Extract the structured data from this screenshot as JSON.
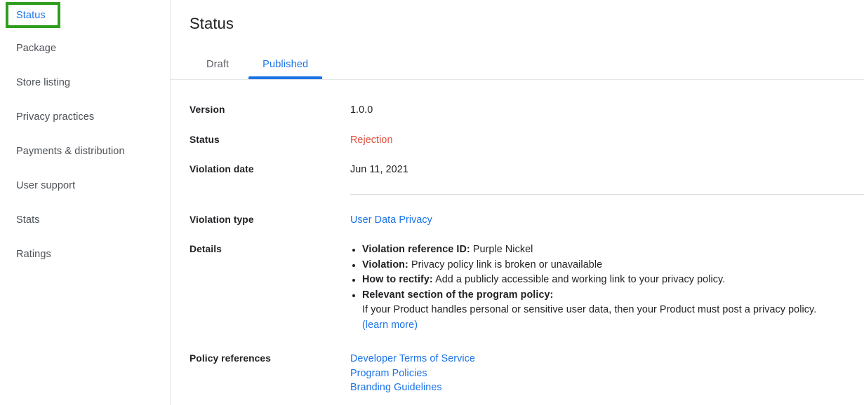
{
  "colors": {
    "accent_blue": "#1a73e8",
    "error_red": "#e0503f",
    "highlight_green": "#2f9e1f",
    "label_dark": "#202124",
    "nav_grey": "#4b5056",
    "divider": "#dadce0"
  },
  "sidebar": {
    "items": [
      {
        "label": "Status",
        "active": true
      },
      {
        "label": "Package",
        "active": false
      },
      {
        "label": "Store listing",
        "active": false
      },
      {
        "label": "Privacy practices",
        "active": false
      },
      {
        "label": "Payments & distribution",
        "active": false
      },
      {
        "label": "User support",
        "active": false
      },
      {
        "label": "Stats",
        "active": false
      },
      {
        "label": "Ratings",
        "active": false
      }
    ]
  },
  "main": {
    "title": "Status",
    "tabs": [
      {
        "label": "Draft",
        "active": false
      },
      {
        "label": "Published",
        "active": true
      }
    ],
    "rows": {
      "version": {
        "label": "Version",
        "value": "1.0.0"
      },
      "status": {
        "label": "Status",
        "value": "Rejection"
      },
      "violation_date": {
        "label": "Violation date",
        "value": "Jun 11, 2021"
      },
      "violation_type": {
        "label": "Violation type",
        "value": "User Data Privacy"
      },
      "details": {
        "label": "Details",
        "bullets": [
          {
            "term": "Violation reference ID:",
            "text": " Purple Nickel"
          },
          {
            "term": "Violation:",
            "text": " Privacy policy link is broken or unavailable"
          },
          {
            "term": "How to rectify:",
            "text": " Add a publicly accessible and working link to your privacy policy."
          },
          {
            "term": "Relevant section of the program policy:",
            "text": "",
            "subtext": "If your Product handles personal or sensitive user data, then your Product must post a privacy policy.",
            "sublink": "(learn more)"
          }
        ]
      },
      "policy_references": {
        "label": "Policy references",
        "links": [
          "Developer Terms of Service",
          "Program Policies",
          "Branding Guidelines"
        ]
      }
    }
  }
}
